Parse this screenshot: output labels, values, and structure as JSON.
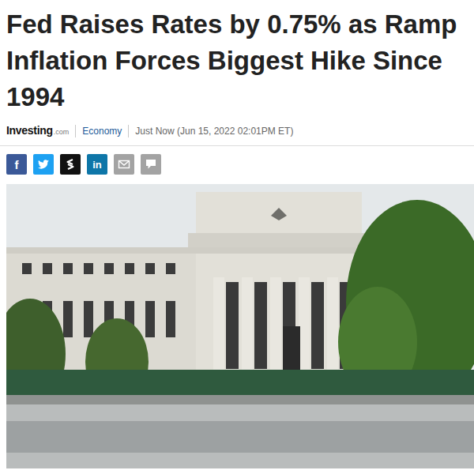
{
  "article": {
    "title_lines": [
      "Fed Raises Rates by 0.75% as Ramp",
      "Inflation Forces Biggest Hike Since",
      "1994"
    ],
    "source": {
      "name": "Investing",
      "suffix": ".com"
    },
    "category": "Economy",
    "timestamp": "Just Now (Jun 15, 2022 02:01PM ET)",
    "share_buttons": [
      {
        "kind": "facebook",
        "label": "f",
        "color": "#3b5998"
      },
      {
        "kind": "twitter",
        "color": "#1da1f2"
      },
      {
        "kind": "stocktwits",
        "color": "#111111"
      },
      {
        "kind": "linkedin",
        "label": "in",
        "color": "#0e76a8"
      },
      {
        "kind": "email",
        "color": "#a3a3a3"
      },
      {
        "kind": "comment",
        "color": "#a3a3a3"
      }
    ]
  }
}
